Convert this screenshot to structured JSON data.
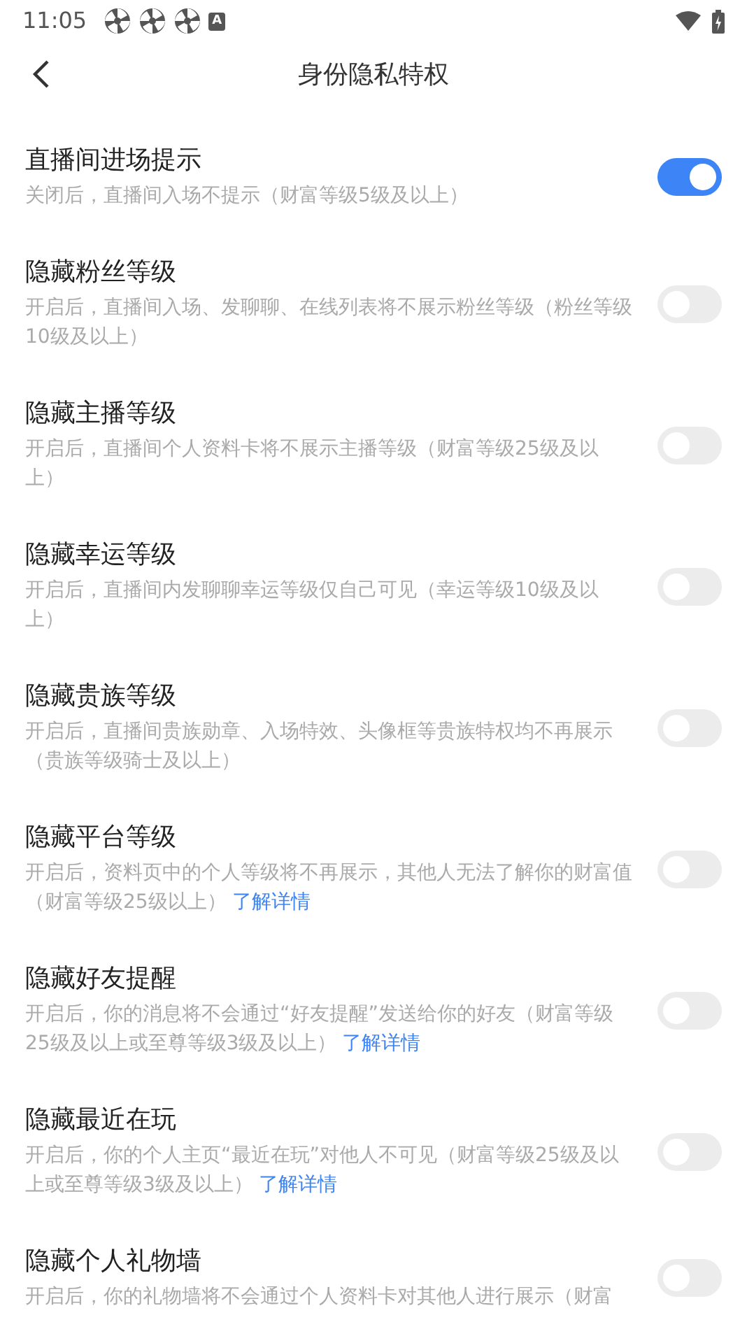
{
  "status_bar": {
    "time": "11:05",
    "notification_icons": [
      {
        "kind": "pinwheel"
      },
      {
        "kind": "pinwheel"
      },
      {
        "kind": "pinwheel"
      },
      {
        "kind": "letter",
        "text": "A"
      }
    ]
  },
  "header": {
    "title": "身份隐私特权"
  },
  "settings": [
    {
      "title": "直播间进场提示",
      "description": "关闭后，直播间入场不提示（财富等级5级及以上）",
      "on": true
    },
    {
      "title": "隐藏粉丝等级",
      "description": "开启后，直播间入场、发聊聊、在线列表将不展示粉丝等级（粉丝等级10级及以上）",
      "on": false
    },
    {
      "title": "隐藏主播等级",
      "description": "开启后，直播间个人资料卡将不展示主播等级（财富等级25级及以上）",
      "on": false
    },
    {
      "title": "隐藏幸运等级",
      "description": "开启后，直播间内发聊聊幸运等级仅自己可见（幸运等级10级及以上）",
      "on": false
    },
    {
      "title": "隐藏贵族等级",
      "description": "开启后，直播间贵族勋章、入场特效、头像框等贵族特权均不再展示（贵族等级骑士及以上）",
      "on": false
    },
    {
      "title": "隐藏平台等级",
      "description": "开启后，资料页中的个人等级将不再展示，其他人无法了解你的财富值（财富等级25级以上）",
      "link": "了解详情",
      "on": false
    },
    {
      "title": "隐藏好友提醒",
      "description": "开启后，你的消息将不会通过“好友提醒”发送给你的好友（财富等级25级及以上或至尊等级3级及以上）",
      "link": "了解详情",
      "on": false
    },
    {
      "title": "隐藏最近在玩",
      "description": "开启后，你的个人主页“最近在玩”对他人不可见（财富等级25级及以上或至尊等级3级及以上）",
      "link": "了解详情",
      "on": false
    },
    {
      "title": "隐藏个人礼物墙",
      "description": "开启后，你的礼物墙将不会通过个人资料卡对其他人进行展示（财富",
      "on": false
    }
  ]
}
